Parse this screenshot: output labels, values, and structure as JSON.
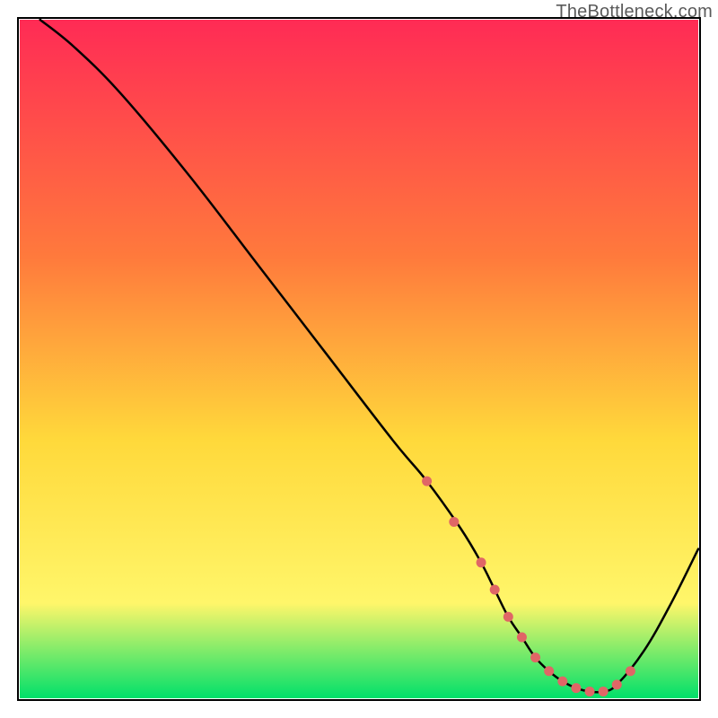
{
  "watermark": "TheBottleneck.com",
  "colors": {
    "gradient_top": "#ff2b55",
    "gradient_mid1": "#ff7a3c",
    "gradient_mid2": "#ffd93b",
    "gradient_mid3": "#fff66a",
    "gradient_bottom": "#00e06a",
    "curve": "#000000",
    "marker": "#e06666",
    "frame": "#000000"
  },
  "chart_data": {
    "type": "line",
    "title": "",
    "xlabel": "",
    "ylabel": "",
    "xlim": [
      0,
      100
    ],
    "ylim": [
      0,
      100
    ],
    "grid": false,
    "legend": false,
    "annotations": [
      "TheBottleneck.com"
    ],
    "series": [
      {
        "name": "curve",
        "x": [
          3,
          8,
          15,
          25,
          35,
          45,
          55,
          60,
          65,
          68,
          70,
          72,
          74,
          76,
          78,
          80,
          82,
          84,
          86,
          88,
          92,
          96,
          100
        ],
        "y": [
          100,
          96,
          89,
          77,
          64,
          51,
          38,
          32,
          25,
          20,
          16,
          12,
          9,
          6,
          4,
          2.5,
          1.5,
          1,
          1,
          2,
          7,
          14,
          22
        ]
      }
    ],
    "markers": {
      "name": "highlight-points",
      "x": [
        60,
        64,
        68,
        70,
        72,
        74,
        76,
        78,
        80,
        82,
        84,
        86,
        88,
        90
      ],
      "y": [
        32,
        26,
        20,
        16,
        12,
        9,
        6,
        4,
        2.5,
        1.5,
        1,
        1,
        2,
        4
      ]
    }
  }
}
